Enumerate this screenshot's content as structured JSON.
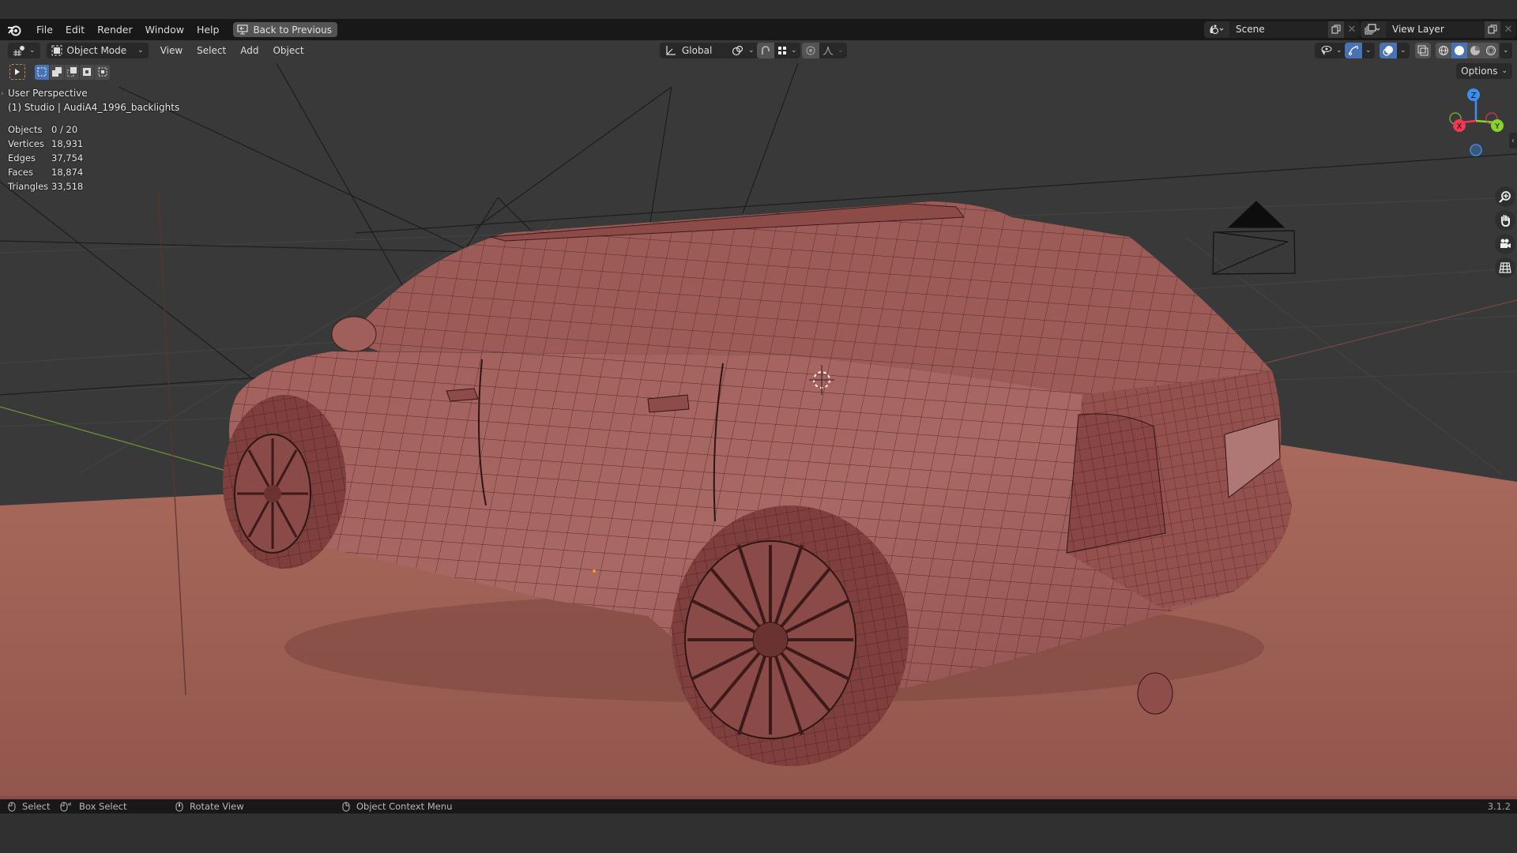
{
  "app": {
    "menu": [
      "File",
      "Edit",
      "Render",
      "Window",
      "Help"
    ],
    "back_button": "Back to Previous",
    "scene": {
      "icon": "scene-icon",
      "name": "Scene"
    },
    "view_layer": {
      "icon": "view-layer-icon",
      "name": "View Layer"
    }
  },
  "viewport_header": {
    "editor_type_icon": "3d-viewport-icon",
    "mode": "Object Mode",
    "menus": [
      "View",
      "Select",
      "Add",
      "Object"
    ],
    "transform_orientation": "Global",
    "pivot_icon": "pivot-point-icon",
    "snap_icon": "snap-magnet-icon",
    "snap_target_icon": "snap-increment-icon",
    "proportional_icon": "proportional-edit-icon",
    "falloff_icon": "falloff-curve-icon",
    "visibility_icon": "object-visibility-icon",
    "gizmo_icon": "gizmo-toggle-icon",
    "overlay_icon": "overlay-toggle-icon",
    "xray_icon": "xray-toggle-icon",
    "shading_modes": [
      "wireframe",
      "solid",
      "material-preview",
      "rendered"
    ],
    "active_shading": "solid",
    "options_label": "Options"
  },
  "toolbar": {
    "active_tool": "select-box",
    "selection_modes": [
      "set",
      "extend",
      "subtract",
      "invert",
      "intersect"
    ],
    "active_selection_mode": "set"
  },
  "overlay": {
    "view_name": "User Perspective",
    "collection_object": "(1) Studio | AudiA4_1996_backlights"
  },
  "stats": [
    {
      "label": "Objects",
      "value": "0 / 20"
    },
    {
      "label": "Vertices",
      "value": "18,931"
    },
    {
      "label": "Edges",
      "value": "37,754"
    },
    {
      "label": "Faces",
      "value": "18,874"
    },
    {
      "label": "Triangles",
      "value": "33,518"
    }
  ],
  "nav_gizmo": {
    "axes": [
      "X",
      "Y",
      "Z"
    ],
    "buttons": [
      "zoom-icon",
      "hand-pan-icon",
      "camera-view-icon",
      "ortho-grid-icon"
    ]
  },
  "colors": {
    "car": "#9a5655",
    "floor": "#9d5e52",
    "grid_bg": "#393939",
    "x_axis": "#ee3a55",
    "y_axis": "#87d22e",
    "z_axis": "#3c8ff0",
    "accent": "#4772b3"
  },
  "statusbar": {
    "items": [
      {
        "icon": "mouse-left-icon",
        "label": "Select"
      },
      {
        "icon": "mouse-drag-icon",
        "label": "Box Select"
      },
      {
        "icon": "mouse-middle-icon",
        "label": "Rotate View"
      },
      {
        "icon": "mouse-right-icon",
        "label": "Object Context Menu"
      }
    ],
    "version": "3.1.2"
  }
}
